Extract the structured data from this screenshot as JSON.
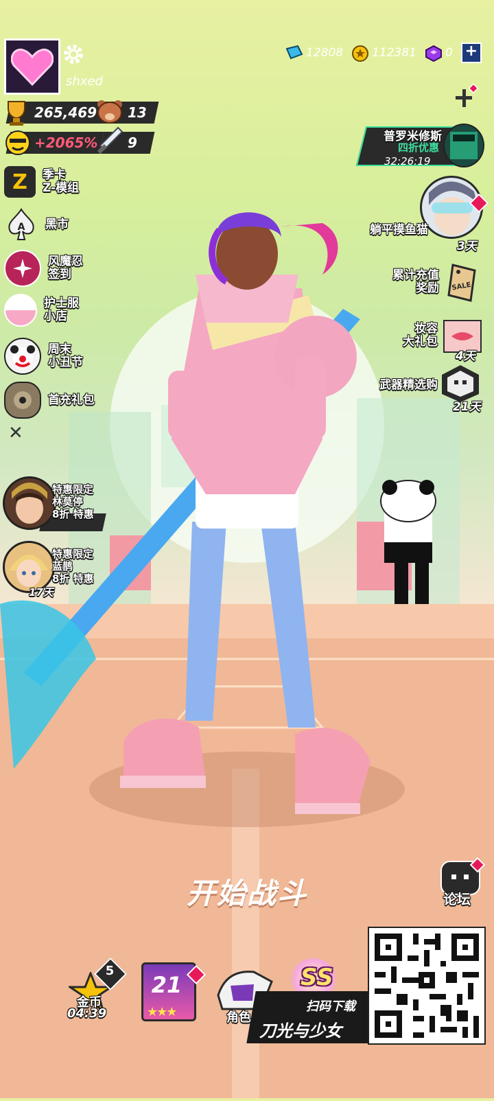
{
  "player": {
    "name": "shxed",
    "trophies": "265,469",
    "bears": "13",
    "bonus_percent": "+2065%",
    "swords": "9"
  },
  "currencies": [
    {
      "icon": "gem-icon",
      "value": "12808"
    },
    {
      "icon": "coin-icon",
      "value": "112381"
    },
    {
      "icon": "cube-icon",
      "value": "0"
    }
  ],
  "left_menu": [
    {
      "icon": "season-z-icon",
      "label_line1": "季卡",
      "label_line2": "Z-模组"
    },
    {
      "icon": "spade-ace-icon",
      "label_line1": "黑市",
      "label_line2": ""
    },
    {
      "icon": "shuriken-icon",
      "label_line1": "风魔忍",
      "label_line2": "签到"
    },
    {
      "icon": "nurse-capsule-icon",
      "label_line1": "护士服",
      "label_line2": "小店"
    },
    {
      "icon": "clown-icon",
      "label_line1": "周末",
      "label_line2": "小丑节"
    },
    {
      "icon": "first-recharge-icon",
      "label_line1": "首充礼包",
      "label_line2": ""
    }
  ],
  "left_promos": [
    {
      "tag": "特惠限定",
      "name": "林莫停",
      "discount": "8折 特惠"
    },
    {
      "tag": "特惠限定",
      "name": "蓝鹊",
      "discount": "8折 特惠",
      "days": "17天"
    }
  ],
  "right_promos": {
    "prometheus": {
      "line1": "普罗米修斯",
      "line2": "四折优惠",
      "timer": "32:26:19"
    },
    "cat": {
      "label": "躺平摸鱼猫",
      "days": "3天"
    },
    "recharge": {
      "line1": "累计充值",
      "line2": "奖励",
      "tag": "SALE"
    },
    "makeup": {
      "line1": "妆容",
      "line2": "大礼包",
      "days": "4天"
    },
    "weapon": {
      "label": "武器精选购",
      "days": "21天"
    }
  },
  "start_battle": "开始战斗",
  "forum": "论坛",
  "bottom_nav": {
    "gold": {
      "label": "金币",
      "timer": "04:39",
      "count": "5"
    },
    "level": {
      "value": "21"
    },
    "character": {
      "label": "角色"
    },
    "rank": {
      "label": "SS"
    }
  },
  "qr": {
    "line1": "扫码下载",
    "line2": "刀光与少女"
  },
  "colors": {
    "accent_pink": "#e8195a",
    "chip_dark": "#2a2a2a",
    "bonus_red": "#ff3a5a"
  }
}
